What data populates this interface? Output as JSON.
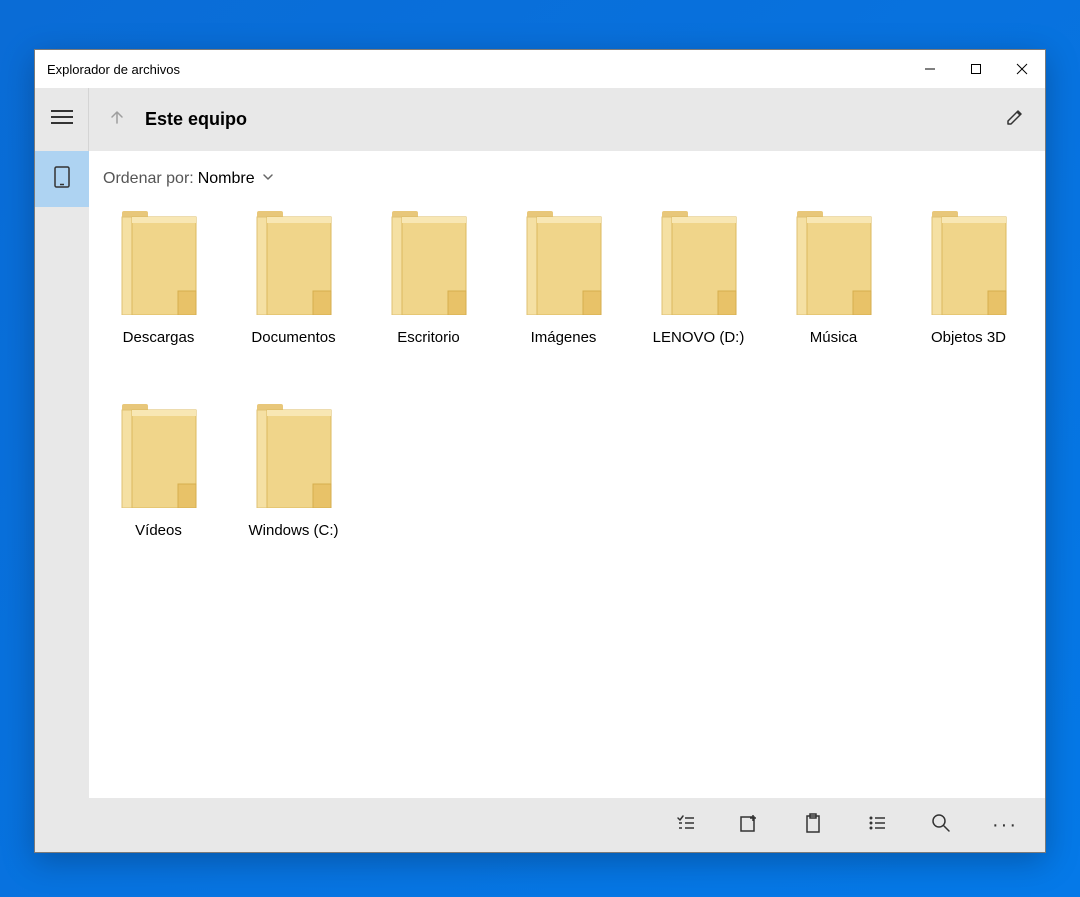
{
  "window": {
    "title": "Explorador de archivos"
  },
  "toolbar": {
    "location": "Este equipo"
  },
  "sort": {
    "label": "Ordenar por:",
    "value": "Nombre"
  },
  "items": [
    {
      "label": "Descargas"
    },
    {
      "label": "Documentos"
    },
    {
      "label": "Escritorio"
    },
    {
      "label": "Imágenes"
    },
    {
      "label": "LENOVO (D:)"
    },
    {
      "label": "Música"
    },
    {
      "label": "Objetos 3D"
    },
    {
      "label": "Vídeos"
    },
    {
      "label": "Windows (C:)"
    }
  ]
}
